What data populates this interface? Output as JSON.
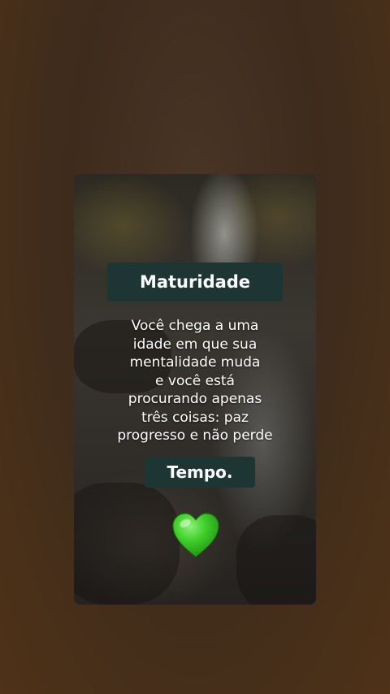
{
  "card": {
    "title": "Maturidade",
    "body": "Você chega a uma\nidade em que sua\nmentalidade muda\ne você está\nprocurando  apenas\ntrês coisas: paz\nprogresso e não perde",
    "footer": "Tempo.",
    "emoji": "green-heart-icon"
  },
  "colors": {
    "background": "#45301f",
    "label_box": "#1d3634",
    "text": "#ffffff",
    "heart": "#3fcf2a"
  }
}
